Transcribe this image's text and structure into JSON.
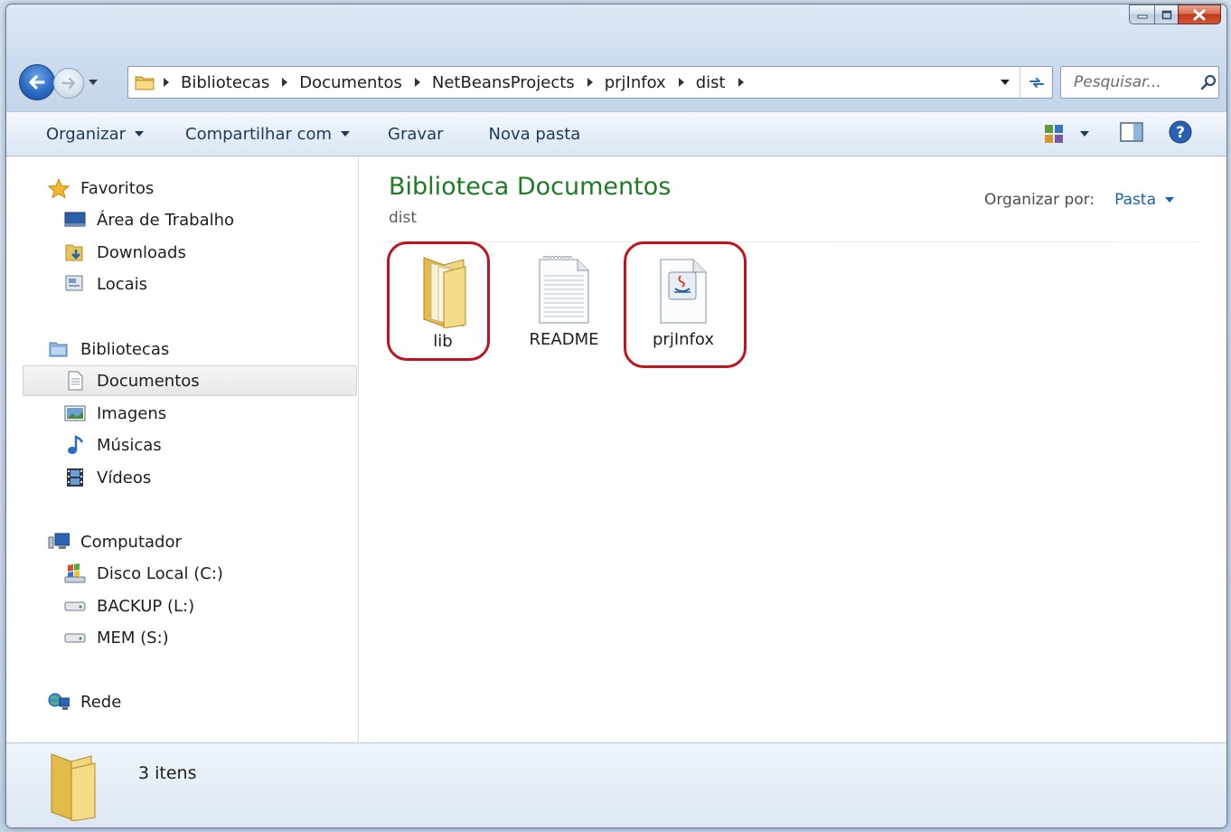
{
  "window": {
    "caption_buttons": {
      "minimize_icon": "minimize-icon",
      "maximize_icon": "maximize-icon",
      "close_icon": "close-icon"
    }
  },
  "address_bar": {
    "breadcrumbs": [
      "Bibliotecas",
      "Documentos",
      "NetBeansProjects",
      "prjInfox",
      "dist"
    ]
  },
  "search": {
    "placeholder": "Pesquisar..."
  },
  "toolbar": {
    "organize": "Organizar",
    "share": "Compartilhar com",
    "burn": "Gravar",
    "new_folder": "Nova pasta"
  },
  "nav": {
    "favorites": {
      "label": "Favoritos",
      "items": [
        "Área de Trabalho",
        "Downloads",
        "Locais"
      ]
    },
    "libraries": {
      "label": "Bibliotecas",
      "items": [
        "Documentos",
        "Imagens",
        "Músicas",
        "Vídeos"
      ],
      "selected": "Documentos"
    },
    "computer": {
      "label": "Computador",
      "items": [
        "Disco Local (C:)",
        "BACKUP (L:)",
        "MEM (S:)"
      ]
    },
    "network": {
      "label": "Rede"
    }
  },
  "main": {
    "title": "Biblioteca Documentos",
    "subtitle": "dist",
    "arrange_label": "Organizar por:",
    "arrange_value": "Pasta",
    "files": [
      {
        "name": "lib",
        "icon": "folder-icon",
        "highlighted": true
      },
      {
        "name": "README",
        "icon": "text-file-icon",
        "highlighted": false
      },
      {
        "name": "prjInfox",
        "icon": "java-jar-icon",
        "highlighted": true
      }
    ]
  },
  "status": {
    "count": "3 itens"
  },
  "colors": {
    "title_green": "#1e7b26",
    "link_blue": "#1b5fb6",
    "highlight_red": "#c1121f"
  }
}
